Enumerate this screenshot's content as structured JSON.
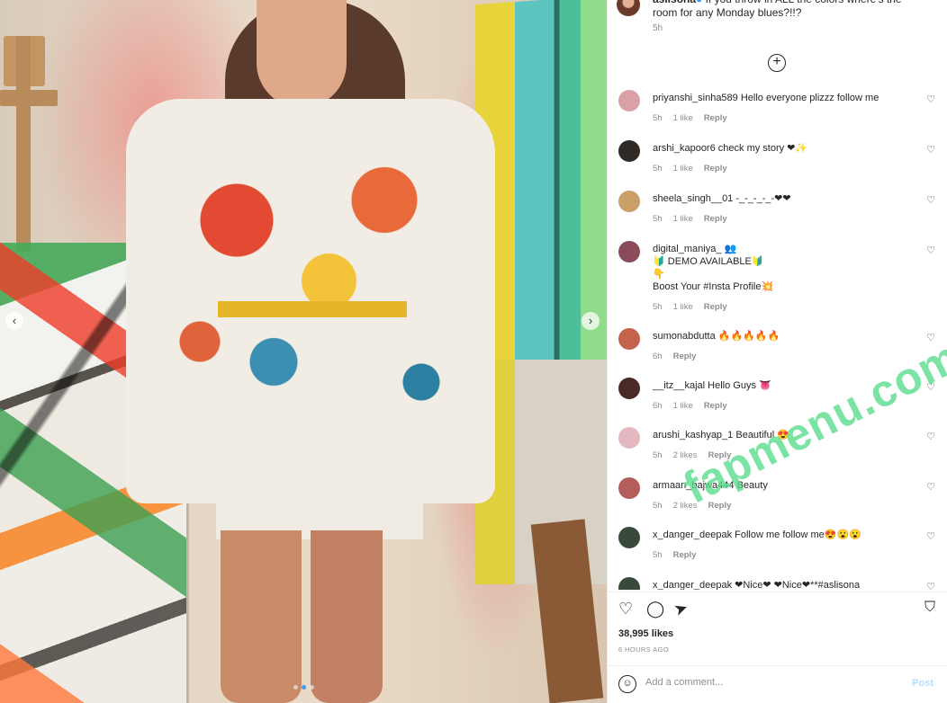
{
  "post": {
    "caption_user": "aslisona",
    "caption_text": " If you throw in ALL the colors where's the room for any Monday blues?!!?",
    "caption_time": "5h",
    "load_more_icon": "plus-circle-icon"
  },
  "comments": [
    {
      "user": "priyanshi_sinha589",
      "text": "Hello everyone plizzz follow me",
      "time": "5h",
      "likes": "1 like",
      "reply": "Reply",
      "avatar": "#d9a0a8"
    },
    {
      "user": "arshi_kapoor6",
      "text": "check my story ❤✨",
      "time": "5h",
      "likes": "1 like",
      "reply": "Reply",
      "avatar": "#2f2a26"
    },
    {
      "user": "sheela_singh__01",
      "text": "-_-_-_-_-❤❤",
      "time": "5h",
      "likes": "1 like",
      "reply": "Reply",
      "avatar": "#caa06a"
    },
    {
      "user": "digital_maniya_",
      "text": "👥\n🔰 DEMO AVAILABLE🔰\n👇\nBoost Your #Insta Profile💥",
      "time": "5h",
      "likes": "1 like",
      "reply": "Reply",
      "avatar": "#8a4b5a"
    },
    {
      "user": "sumonabdutta",
      "text": "🔥🔥🔥🔥🔥",
      "time": "6h",
      "likes": "",
      "reply": "Reply",
      "avatar": "#c4634c"
    },
    {
      "user": "__itz__kajal",
      "text": "Hello Guys 👅",
      "time": "6h",
      "likes": "1 like",
      "reply": "Reply",
      "avatar": "#4a2a24"
    },
    {
      "user": "arushi_kashyap_1",
      "text": "Beautiful 😍",
      "time": "5h",
      "likes": "2 likes",
      "reply": "Reply",
      "avatar": "#e3b8c0"
    },
    {
      "user": "armaan_bajwa444",
      "text": "Beauty",
      "time": "5h",
      "likes": "2 likes",
      "reply": "Reply",
      "avatar": "#b55c5c"
    },
    {
      "user": "x_danger_deepak",
      "text": "Follow me follow me😍😮😮",
      "time": "5h",
      "likes": "",
      "reply": "Reply",
      "avatar": "#3a4a3a"
    },
    {
      "user": "x_danger_deepak",
      "text": "❤Nice❤ ❤Nice❤**#aslisona",
      "time": "",
      "likes": "",
      "reply": "",
      "avatar": "#3a4a3a"
    }
  ],
  "actions": {
    "likes": "38,995 likes",
    "posted": "6 HOURS AGO",
    "like_icon": "heart-icon",
    "comment_icon": "comment-icon",
    "share_icon": "share-icon",
    "save_icon": "bookmark-icon"
  },
  "comment_box": {
    "placeholder": "Add a comment...",
    "post_label": "Post"
  },
  "carousel": {
    "dot_count": 3,
    "active_index": 1
  },
  "watermark": "fapmenu.com"
}
